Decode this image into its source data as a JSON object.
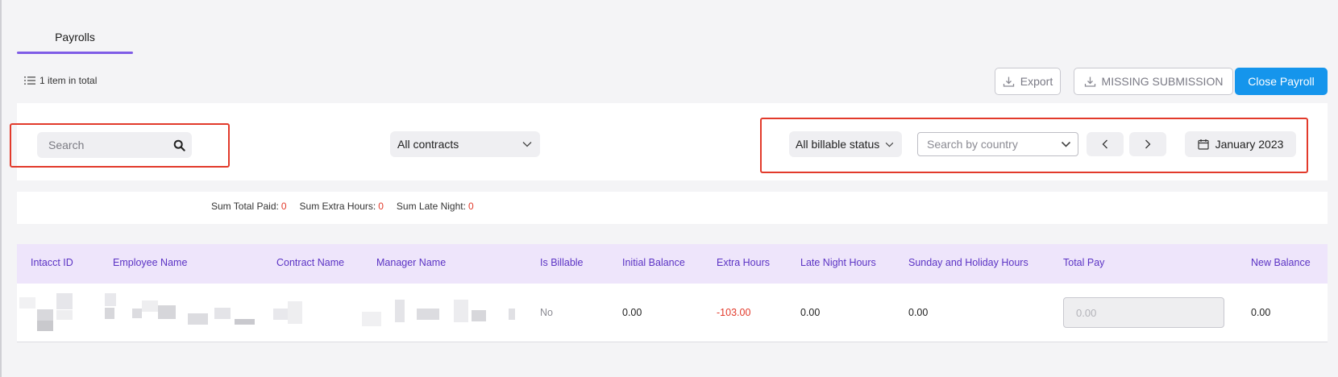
{
  "tabs": [
    {
      "label": "Payrolls",
      "active": true
    }
  ],
  "summary": {
    "count_text": "1 item in total"
  },
  "toolbar": {
    "export_label": "Export",
    "missing_label": "MISSING SUBMISSION",
    "close_label": "Close Payroll"
  },
  "filters": {
    "search_placeholder": "Search",
    "contracts_value": "All contracts",
    "billable_value": "All billable status",
    "country_placeholder": "Search by country",
    "month_value": "January 2023"
  },
  "sums": [
    {
      "label": "Sum Total Paid:",
      "value": "0"
    },
    {
      "label": "Sum Extra Hours:",
      "value": "0"
    },
    {
      "label": "Sum Late Night:",
      "value": "0"
    }
  ],
  "table": {
    "columns": [
      "Intacct ID",
      "Employee Name",
      "Contract Name",
      "Manager Name",
      "Is Billable",
      "Initial Balance",
      "Extra Hours",
      "Late Night Hours",
      "Sunday and Holiday Hours",
      "Total Pay",
      "New Balance"
    ],
    "rows": [
      {
        "is_billable": "No",
        "initial_balance": "0.00",
        "extra_hours": "-103.00",
        "late_night_hours": "0.00",
        "sunday_holiday_hours": "0.00",
        "total_pay": "0.00",
        "new_balance": "0.00"
      }
    ]
  },
  "colors": {
    "accent": "#7f5ce6",
    "primary": "#1595ec",
    "negative": "#e23a2b",
    "highlight": "#e23a2b"
  }
}
